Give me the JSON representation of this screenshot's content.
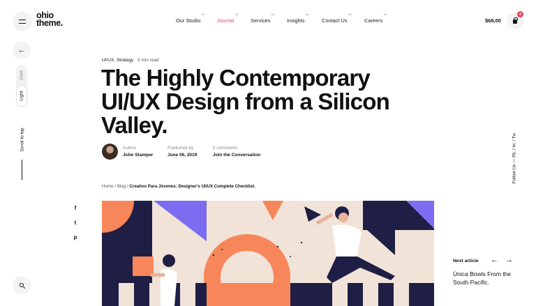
{
  "logo": {
    "line1": "ohio",
    "line2": "theme."
  },
  "nav": [
    {
      "label": "Our Studio",
      "num": "01"
    },
    {
      "label": "Journal",
      "num": "02"
    },
    {
      "label": "Services",
      "num": "03"
    },
    {
      "label": "Insights",
      "num": "04"
    },
    {
      "label": "Contact Us",
      "num": "05"
    },
    {
      "label": "Careers",
      "num": "06"
    }
  ],
  "cart": {
    "price": "$68,00",
    "count": "4"
  },
  "theme_toggle": {
    "dark": "Dark",
    "light": "Light"
  },
  "scroll_to_top": "Scroll to top",
  "article": {
    "categories": "UI/UX, Strategy",
    "separator": "·",
    "read_time": "5 min read",
    "title": "The Highly Contemporary UI/UX Design from a Silicon Valley.",
    "author_label": "Author",
    "author_name": "John Stamper",
    "published_label": "Published by",
    "published_date": "June 06, 2019",
    "comments_label": "5 comments",
    "comments_link": "Join the Conversation"
  },
  "breadcrumb": {
    "home": "Home",
    "sep1": "/",
    "blog": "Blog",
    "sep2": "/",
    "current": "Creativo Para Jóvenes: Designer's UI/UX Complete Checklist."
  },
  "social": {
    "facebook": "f",
    "twitter": "t",
    "pinterest": "p"
  },
  "follow_us": "Follow Us — Fb. / In. / Tw.",
  "next_article": {
    "label": "Next article",
    "prev_arrow": "←",
    "next_arrow": "→",
    "title": "Única Bowls From the South Pacific."
  },
  "icons": {
    "menu": "menu-icon",
    "back": "arrow-left-icon",
    "search": "search-icon",
    "cart": "shopping-bag-icon"
  },
  "colors": {
    "accent": "#e8435a",
    "orange": "#f7875a",
    "navy": "#1f1f45",
    "purple": "#7b6cf0",
    "peach": "#f1e3d8"
  }
}
